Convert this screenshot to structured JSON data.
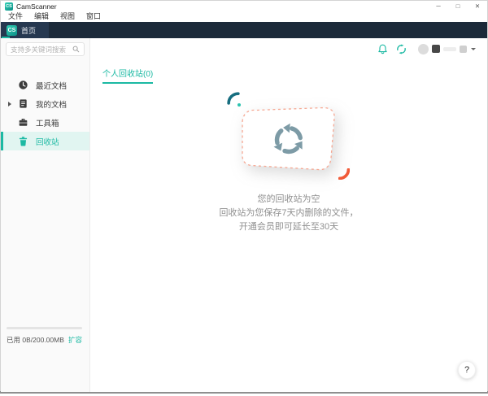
{
  "app": {
    "name": "CamScanner",
    "logo_text": "CS"
  },
  "window_controls": {
    "minimize": "─",
    "maximize": "□",
    "close": "✕"
  },
  "menu_bar": {
    "items": [
      {
        "label": "文件"
      },
      {
        "label": "编辑"
      },
      {
        "label": "视图"
      },
      {
        "label": "窗口"
      }
    ]
  },
  "tab_bar": {
    "active_tab_label": "首页"
  },
  "toolbar": {
    "icons": [
      "bell-icon",
      "sync-icon",
      "avatar",
      "vip-badge",
      "dropdown-caret"
    ]
  },
  "sidebar": {
    "search": {
      "placeholder": "支持多关键词搜索",
      "value": ""
    },
    "items": [
      {
        "label": "最近文档",
        "icon": "clock",
        "selected": false
      },
      {
        "label": "我的文档",
        "icon": "document",
        "selected": false,
        "expandable": true
      },
      {
        "label": "工具箱",
        "icon": "toolbox",
        "selected": false
      },
      {
        "label": "回收站",
        "icon": "trash",
        "selected": true
      }
    ],
    "storage": {
      "used_label": "已用 0B/200.00MB",
      "expand_label": "扩容",
      "progress_percent": 0
    }
  },
  "main": {
    "tab_label": "个人回收站(0)",
    "empty_state": {
      "title": "您的回收站为空",
      "line1": "回收站为您保存7天内删除的文件，",
      "line2": "开通会员即可延长至30天"
    },
    "help_label": "?"
  },
  "colors": {
    "accent_teal": "#1bb9a3",
    "navy_bar": "#1c2a3a",
    "selected_bg": "#e1f5f1",
    "recycle_arrow": "#7d9ba6",
    "dashed_coral": "#f6a893",
    "deco_orange": "#f15a38",
    "deco_dark_teal": "#176e80"
  }
}
